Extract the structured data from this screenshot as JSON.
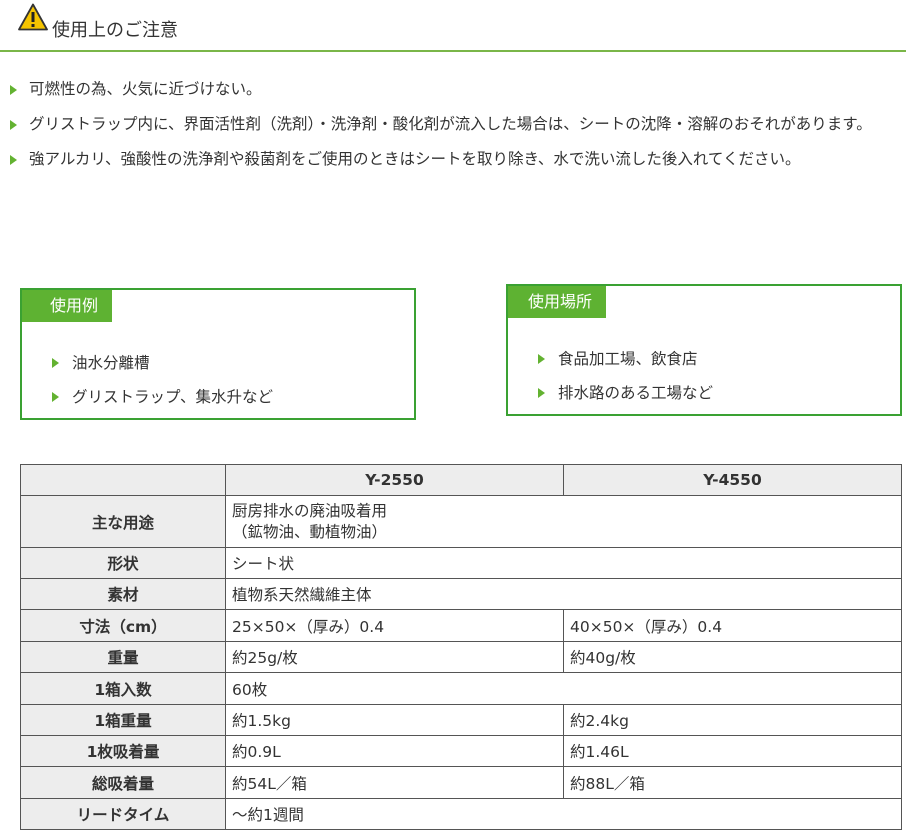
{
  "header": {
    "title": "使用上のご注意",
    "icon": "warning-icon"
  },
  "notes": [
    "可燃性の為、火気に近づけない。",
    "グリストラップ内に、界面活性剤（洗剤）・洗浄剤・酸化剤が流入した場合は、シートの沈降・溶解のおそれがあります。",
    "強アルカリ、強酸性の洗浄剤や殺菌剤をご使用のときはシートを取り除き、水で洗い流した後入れてください。"
  ],
  "usage_examples": {
    "label": "使用例",
    "items": [
      "油水分離槽",
      "グリストラップ、集水升など"
    ]
  },
  "usage_places": {
    "label": "使用場所",
    "items": [
      "食品加工場、飲食店",
      "排水路のある工場など"
    ]
  },
  "spec_table": {
    "headers": [
      "",
      "Y-2550",
      "Y-4550"
    ],
    "rows": [
      {
        "label": "主な用途",
        "lines": [
          "厨房排水の廃油吸着用",
          "（鉱物油、動植物油）"
        ]
      },
      {
        "label": "形状",
        "value": "シート状"
      },
      {
        "label": "素材",
        "value": "植物系天然繊維主体"
      },
      {
        "label": "寸法（cm）",
        "y2550": "25×50×（厚み）0.4",
        "y4550": "40×50×（厚み）0.4"
      },
      {
        "label": "重量",
        "y2550": "約25g/枚",
        "y4550": "約40g/枚"
      },
      {
        "label": "1箱入数",
        "value": "60枚"
      },
      {
        "label": "1箱重量",
        "y2550": "約1.5kg",
        "y4550": "約2.4kg"
      },
      {
        "label": "1枚吸着量",
        "y2550": "約0.9L",
        "y4550": "約1.46L"
      },
      {
        "label": "総吸着量",
        "y2550": "約54L／箱",
        "y4550": "約88L／箱"
      },
      {
        "label": "リードタイム",
        "value": "～約1週間"
      }
    ]
  },
  "colors": {
    "accent_green": "#5eb232",
    "box_border": "#3aa132",
    "header_bg": "#ededed",
    "warning_yellow": "#f5c400"
  }
}
